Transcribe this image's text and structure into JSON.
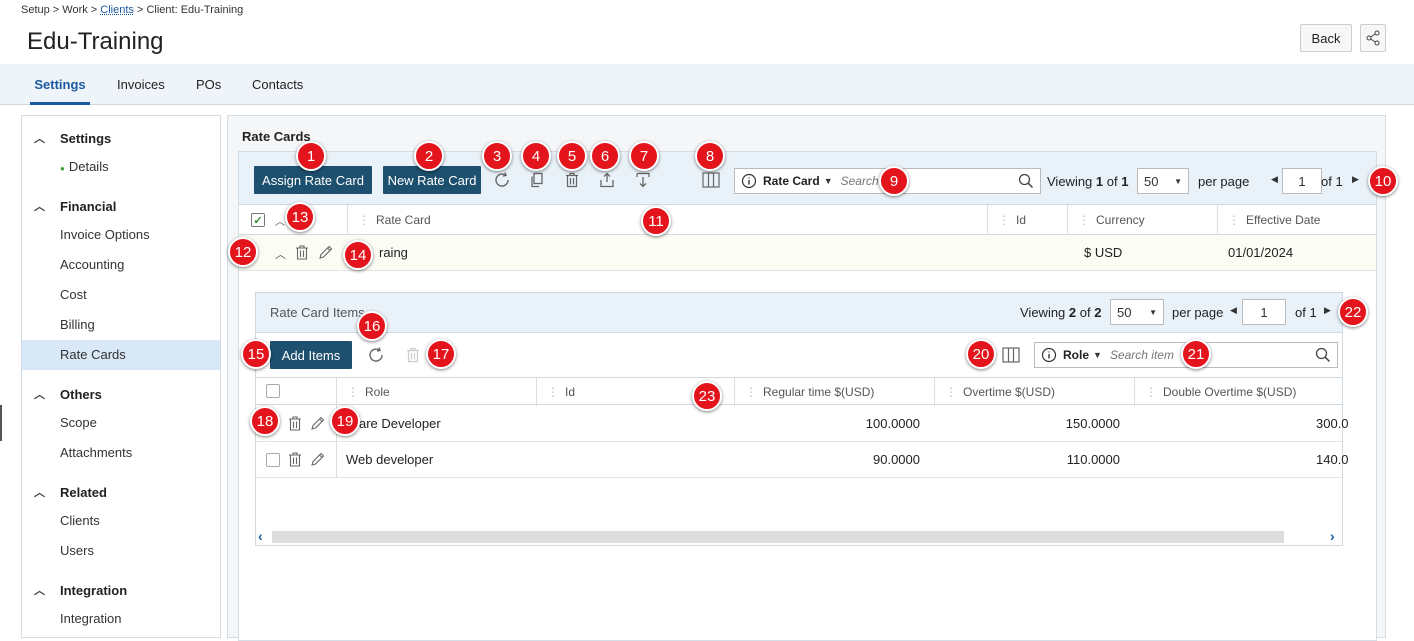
{
  "breadcrumb": {
    "p1": "Setup > Work > ",
    "clients": "Clients",
    "p2": " > Client: Edu-Training"
  },
  "page": {
    "title": "Edu-Training",
    "back": "Back"
  },
  "tabs": [
    "Settings",
    "Invoices",
    "POs",
    "Contacts"
  ],
  "sidebar": {
    "settings": "Settings",
    "details": "Details",
    "financial": "Financial",
    "invoice_options": "Invoice Options",
    "accounting": "Accounting",
    "cost": "Cost",
    "billing": "Billing",
    "rate_cards": "Rate Cards",
    "others": "Others",
    "scope": "Scope",
    "attachments": "Attachments",
    "related": "Related",
    "clients": "Clients",
    "users": "Users",
    "integration_h": "Integration",
    "integration": "Integration"
  },
  "main": {
    "title": "Rate Cards",
    "assign_btn": "Assign Rate Card",
    "new_btn": "New Rate Card",
    "search_scope": "Rate Card",
    "search_placeholder": "Search",
    "viewing": "Viewing",
    "view_a": "1",
    "of": "of",
    "view_b": "1",
    "per_page_value": "50",
    "per_page": "per page",
    "page_num": "1",
    "of_pages": "of 1",
    "cols": {
      "rate_card": "Rate Card",
      "id": "Id",
      "currency": "Currency",
      "effective": "Effective Date"
    },
    "row": {
      "name": "raing",
      "currency": "$ USD",
      "date": "01/01/2024"
    }
  },
  "sub": {
    "title": "Rate Card Items",
    "viewing": "Viewing",
    "view_a": "2",
    "of": "of",
    "view_b": "2",
    "per_page_value": "50",
    "per_page": "per page",
    "page_num": "1",
    "of_pages": "of 1",
    "add_btn": "Add Items",
    "search_scope": "Role",
    "search_placeholder": "Search item",
    "cols": {
      "role": "Role",
      "id": "Id",
      "regular": "Regular time $(USD)",
      "overtime": "Overtime $(USD)",
      "double": "Double Overtime $(USD)"
    },
    "rows": [
      {
        "role": "tware Developer",
        "regular": "100.0000",
        "overtime": "150.0000",
        "double": "300.0"
      },
      {
        "role": "Web developer",
        "regular": "90.0000",
        "overtime": "110.0000",
        "double": "140.0"
      }
    ]
  },
  "callouts": [
    "1",
    "2",
    "3",
    "4",
    "5",
    "6",
    "7",
    "8",
    "9",
    "10",
    "11",
    "12",
    "13",
    "14",
    "15",
    "16",
    "17",
    "18",
    "19",
    "20",
    "21",
    "22",
    "23"
  ],
  "colors": {
    "accent": "#1a5a9e",
    "dark_button": "#1d4f6e",
    "callout": "#e3141c"
  }
}
